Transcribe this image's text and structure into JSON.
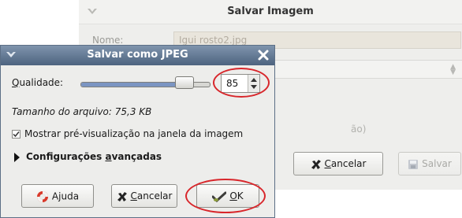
{
  "background_dialog": {
    "title": "Salvar Imagem",
    "name_label": "Nome:",
    "name_value": "Igui rosto2.jpg",
    "ghost_text": "ão)",
    "cancel_label": "Cancelar",
    "save_label": "Salvar"
  },
  "jpeg_dialog": {
    "title": "Salvar como JPEG",
    "quality_label": "Qualidade:",
    "quality_value": "85",
    "quality_slider_fraction": 0.85,
    "file_size_text": "Tamanho do arquivo: 75,3 KB",
    "preview_checkbox_label": "Mostrar pré-visualização na janela da imagem",
    "preview_checked": true,
    "advanced_label": "Configurações avançadas",
    "help_label": "Ajuda",
    "cancel_label": "Cancelar",
    "ok_label": "OK"
  },
  "icons": [
    "window-menu-icon",
    "close-icon",
    "help-lifebuoy-icon",
    "cancel-x-icon",
    "ok-check-icon",
    "save-floppy-icon",
    "checkbox-check-icon",
    "expander-arrow-icon"
  ],
  "colors": {
    "titlebar": "#4d637f",
    "highlight": "#d8262b",
    "slider_fill": "#7b95c2"
  }
}
